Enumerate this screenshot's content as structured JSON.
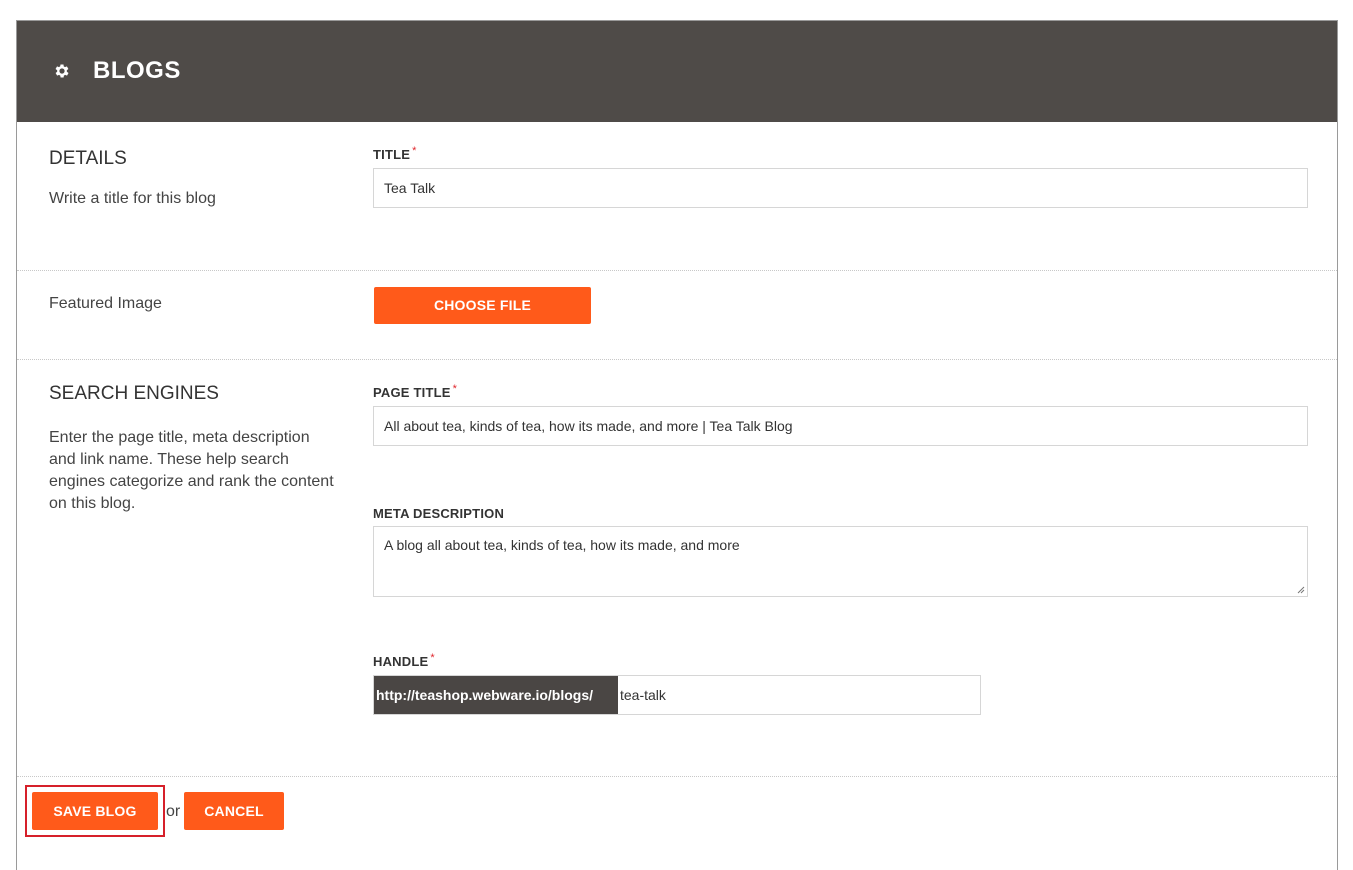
{
  "header": {
    "title": "BLOGS",
    "icon": "gear-icon"
  },
  "details": {
    "heading": "DETAILS",
    "description": "Write a title for this blog",
    "title_label": "TITLE",
    "required_mark": "*",
    "title_value": "Tea Talk"
  },
  "featured_image": {
    "label": "Featured Image",
    "choose_file_label": "CHOOSE FILE"
  },
  "search_engines": {
    "heading": "SEARCH ENGINES",
    "description": "Enter the page title, meta description and link name. These help search engines categorize and rank the content on this blog.",
    "page_title_label": "PAGE TITLE",
    "page_title_value": "All about tea, kinds of tea, how its made, and more | Tea Talk Blog",
    "meta_description_label": "META DESCRIPTION",
    "meta_description_value": "A blog all about tea, kinds of tea, how its made, and more",
    "handle_label": "HANDLE",
    "handle_prefix": "http://teashop.webware.io/blogs/",
    "handle_value": "tea-talk"
  },
  "actions": {
    "save_label": "SAVE BLOG",
    "or_text": "or",
    "cancel_label": "CANCEL"
  },
  "colors": {
    "header_bg": "#4f4b48",
    "accent": "#ff5a1a",
    "required": "#e0262c",
    "highlight": "#d6202a"
  }
}
